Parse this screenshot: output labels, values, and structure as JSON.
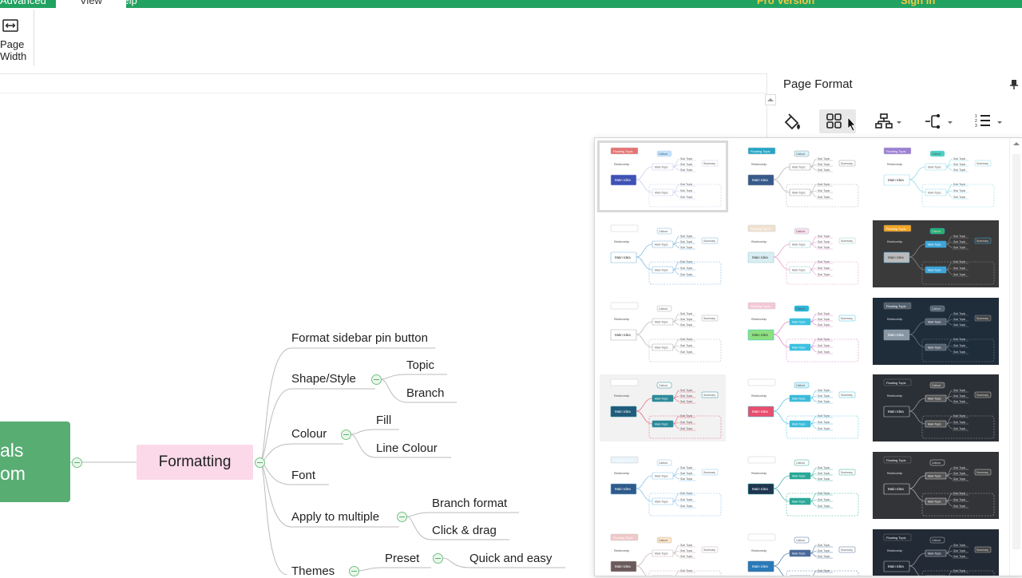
{
  "menu": {
    "tabs": [
      {
        "label": "Advanced"
      },
      {
        "label": "View"
      },
      {
        "label": "Help"
      }
    ],
    "pro_label": "Pro Version",
    "signin_label": "Sign In"
  },
  "toolbar": {
    "page_width_line1": "Page",
    "page_width_line2": "Width"
  },
  "mindmap": {
    "main_line1": "als",
    "main_line2": "om",
    "center": "Formatting",
    "branches": [
      "Format sidebar pin button",
      "Shape/Style",
      "Topic",
      "Branch",
      "Colour",
      "Fill",
      "Line Colour",
      "Font",
      "Apply to multiple",
      "Branch format",
      "Click & drag",
      "Themes",
      "Preset",
      "Quick and easy"
    ]
  },
  "panel": {
    "title": "Page Format",
    "tools": [
      "paint-bucket-icon",
      "theme-grid-icon",
      "org-layout-icon",
      "branch-connector-icon",
      "numbering-icon"
    ]
  },
  "themes": {
    "labels": {
      "floating": "Floating Topic",
      "main": "Main Idea",
      "main_topic": "Main Topic",
      "sub_topic": "Sub Topic",
      "callout": "Callout",
      "summary": "Summary",
      "relationship": "Relationship"
    },
    "accent_colors": {
      "green": "#22a260",
      "pink_node": "#fbd9e8",
      "main_node": "#58ad73"
    }
  }
}
